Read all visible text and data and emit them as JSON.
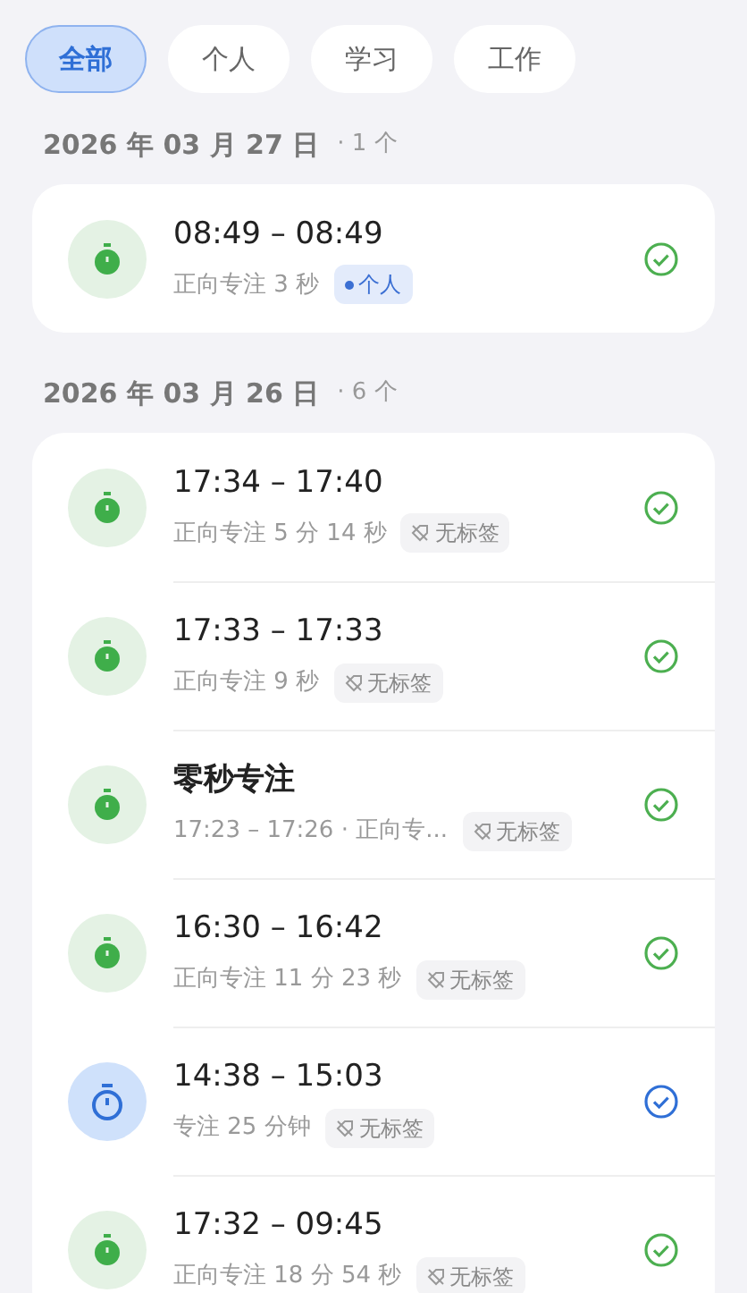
{
  "filters": [
    {
      "label": "全部",
      "selected": true
    },
    {
      "label": "个人",
      "selected": false
    },
    {
      "label": "学习",
      "selected": false
    },
    {
      "label": "工作",
      "selected": false
    }
  ],
  "groups": [
    {
      "date": "2026 年 03 月 27 日",
      "count": "· 1 个",
      "sessions": [
        {
          "kind": "forward",
          "title": "08:49 – 08:49",
          "detail": "正向专注 3 秒",
          "tag": {
            "kind": "personal",
            "label": "个人"
          }
        }
      ]
    },
    {
      "date": "2026 年 03 月 26 日",
      "count": "· 6 个",
      "sessions": [
        {
          "kind": "forward",
          "title": "17:34 – 17:40",
          "detail": "正向专注 5 分 14 秒",
          "tag": {
            "kind": "none",
            "label": "无标签"
          }
        },
        {
          "kind": "forward",
          "title": "17:33 – 17:33",
          "detail": "正向专注 9 秒",
          "tag": {
            "kind": "none",
            "label": "无标签"
          }
        },
        {
          "kind": "forward",
          "title": "零秒专注",
          "detail": "17:23 – 17:26 · 正向专...",
          "tag": {
            "kind": "none",
            "label": "无标签"
          }
        },
        {
          "kind": "forward",
          "title": "16:30 – 16:42",
          "detail": "正向专注 11 分 23 秒",
          "tag": {
            "kind": "none",
            "label": "无标签"
          }
        },
        {
          "kind": "countdown",
          "title": "14:38 – 15:03",
          "detail": "专注 25 分钟",
          "tag": {
            "kind": "none",
            "label": "无标签"
          }
        },
        {
          "kind": "forward",
          "title": "17:32 – 09:45",
          "detail": "正向专注 18 分 54 秒",
          "tag": {
            "kind": "none",
            "label": "无标签"
          }
        }
      ]
    }
  ]
}
